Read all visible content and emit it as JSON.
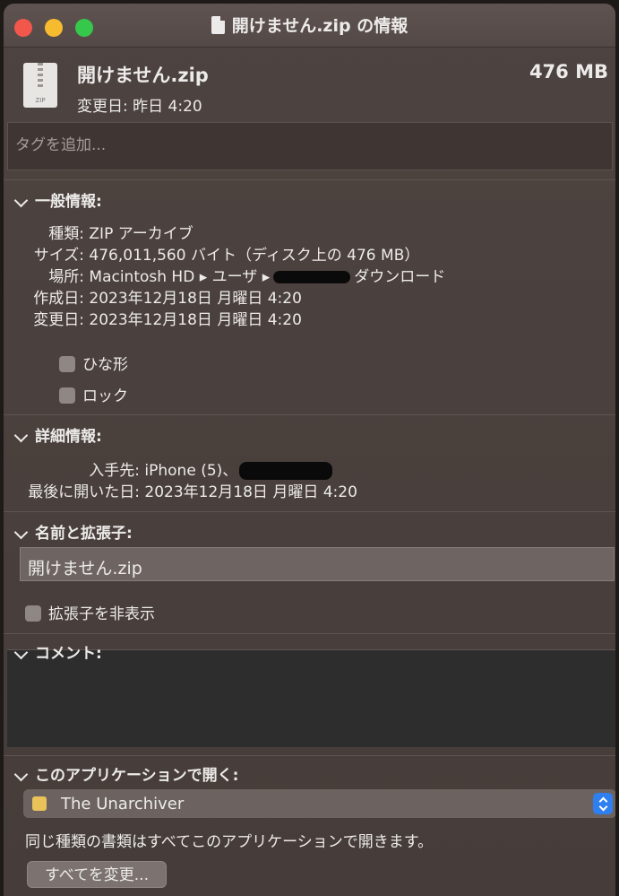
{
  "window": {
    "title": "開けません.zip の情報"
  },
  "header": {
    "file_name": "開けません.zip",
    "modified": "変更日: 昨日 4:20",
    "size": "476 MB",
    "icon_label": "ZIP"
  },
  "tags": {
    "placeholder": "タグを追加..."
  },
  "general": {
    "title": "一般情報:",
    "rows": [
      {
        "key": "種類:",
        "value": "ZIP アーカイブ"
      },
      {
        "key": "サイズ:",
        "value": "476,011,560 バイト（ディスク上の 476 MB）"
      },
      {
        "key": "場所:",
        "value_prefix": "Macintosh HD ▸ ユーザ ▸",
        "value_suffix": "ダウンロード"
      },
      {
        "key": "作成日:",
        "value": "2023年12月18日 月曜日 4:20"
      },
      {
        "key": "変更日:",
        "value": "2023年12月18日 月曜日 4:20"
      }
    ],
    "stationery_label": "ひな形",
    "locked_label": "ロック"
  },
  "details": {
    "title": "詳細情報:",
    "rows": [
      {
        "key": "入手先:",
        "value": "iPhone (5)、"
      },
      {
        "key": "最後に開いた日:",
        "value": "2023年12月18日 月曜日 4:20"
      }
    ]
  },
  "name_ext": {
    "title": "名前と拡張子:",
    "value": "開けません.zip",
    "hide_ext_label": "拡張子を非表示"
  },
  "comments": {
    "title": "コメント:"
  },
  "open_with": {
    "title": "このアプリケーションで開く:",
    "app": "The Unarchiver",
    "info": "同じ種類の書類はすべてこのアプリケーションで開きます。",
    "change_all": "すべてを変更..."
  }
}
